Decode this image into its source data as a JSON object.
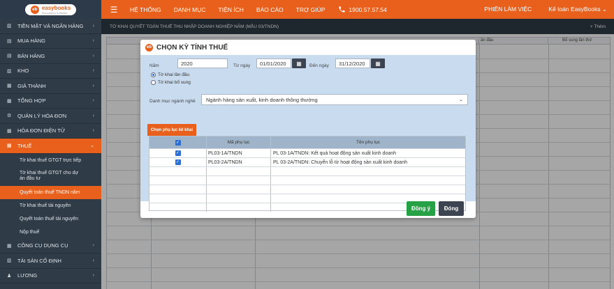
{
  "topbar": {
    "logo_name": "easybooks",
    "logo_sub": "Accounting Software",
    "nav": [
      "HỆ THỐNG",
      "DANH MỤC",
      "TIỆN ÍCH",
      "BÁO CÁO",
      "TRỢ GIÚP"
    ],
    "phone": "1900.57.57.54",
    "session": "PHIÊN LÀM VIỆC",
    "user": "Kế toán EasyBooks"
  },
  "sidebar": {
    "items": [
      {
        "label": "TIỀN MẶT VÀ NGÂN HÀNG",
        "icon": "bank-icon"
      },
      {
        "label": "MUA HÀNG",
        "icon": "cart-icon"
      },
      {
        "label": "BÁN HÀNG",
        "icon": "cart-icon"
      },
      {
        "label": "KHO",
        "icon": "warehouse-icon"
      },
      {
        "label": "GIÁ THÀNH",
        "icon": "document-icon"
      },
      {
        "label": "TỔNG HỢP",
        "icon": "document-icon"
      },
      {
        "label": "QUẢN LÝ HÓA ĐƠN",
        "icon": "gear-icon"
      },
      {
        "label": "HÓA ĐƠN ĐIỆN TỬ",
        "icon": "document-icon"
      },
      {
        "label": "THUẾ",
        "icon": "document-icon"
      }
    ],
    "sub_items": [
      "Tờ khai thuế GTGT trực tiếp",
      "Tờ khai thuế GTGT cho dự án đầu tư",
      "Quyết toán thuế TNDN năm",
      "Tờ khai thuế tài nguyên",
      "Quyết toán thuế tài nguyên",
      "Nộp thuế"
    ],
    "bottom_items": [
      {
        "label": "CÔNG CỤ DỤNG CỤ",
        "icon": "document-icon"
      },
      {
        "label": "TÀI SẢN CỐ ĐỊNH",
        "icon": "building-icon"
      },
      {
        "label": "LƯƠNG",
        "icon": "user-icon"
      }
    ]
  },
  "main": {
    "header": "TỜ KHAI QUYẾT TOÁN THUẾ THU NHẬP DOANH NGHIỆP NĂM (MẪU 03/TNDN)",
    "add_label": "+ Thêm",
    "grid_cols": [
      "ần đầu",
      "Bổ sung lần thứ"
    ]
  },
  "modal": {
    "title": "CHỌN KỲ TÍNH THUẾ",
    "year_label": "Năm",
    "year_value": "2020",
    "from_label": "Từ ngày",
    "from_value": "01/01/2020",
    "to_label": "Đến ngày",
    "to_value": "31/12/2020",
    "radio_first": "Tờ khai lần đầu",
    "radio_supplement": "Tờ khai bổ sung",
    "industry_label": "Danh mục ngành nghề",
    "industry_value": "Ngành hàng sản xuất, kinh doanh thông thường",
    "tab_label": "Chọn phụ lục kê khai",
    "table": {
      "headers": [
        "Mã phụ lục",
        "Tên phụ lục"
      ],
      "rows": [
        {
          "code": "PL03-1A/TNDN",
          "name": "PL 03-1A/TNDN: Kết quả hoạt động sản xuất kinh doanh"
        },
        {
          "code": "PL03-2A/TNDN",
          "name": "PL 03-2A/TNDN: Chuyển lỗ từ hoạt động sản xuất kinh doanh"
        }
      ]
    },
    "ok_label": "Đồng ý",
    "close_label": "Đóng"
  }
}
